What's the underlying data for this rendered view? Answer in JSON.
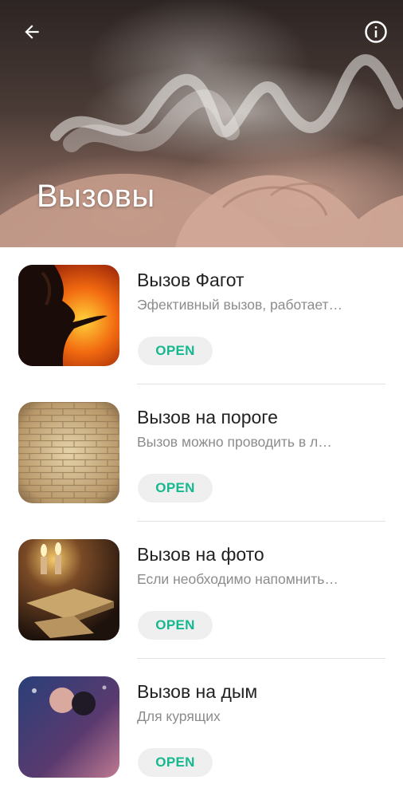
{
  "header": {
    "title": "Вызовы",
    "back_icon": "arrow-left-icon",
    "info_icon": "info-icon"
  },
  "items": [
    {
      "title": "Вызов Фагот",
      "description": "Эфективный вызов, работает…",
      "button": "OPEN",
      "thumb_icon": "woman-blowing-fire-image"
    },
    {
      "title": "Вызов на пороге",
      "description": "Вызов можно проводить в л…",
      "button": "OPEN",
      "thumb_icon": "brick-wall-image"
    },
    {
      "title": "Вызов на фото",
      "description": "Если необходимо напомнить…",
      "button": "OPEN",
      "thumb_icon": "candles-book-image"
    },
    {
      "title": "Вызов на дым",
      "description": "Для курящих",
      "button": "OPEN",
      "thumb_icon": "couple-image"
    }
  ],
  "colors": {
    "accent": "#16b88f",
    "title_text": "#222222",
    "secondary_text": "#8c8c8c",
    "button_bg": "#efefef"
  }
}
